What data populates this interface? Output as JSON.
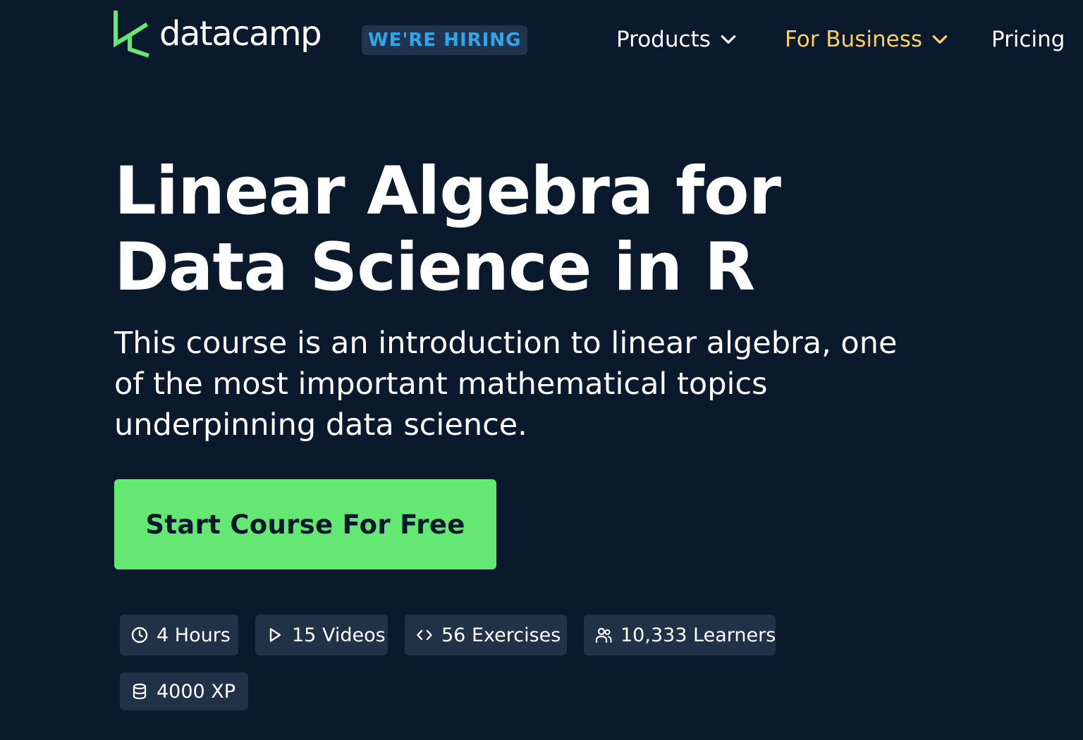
{
  "header": {
    "brand_name": "datacamp",
    "hiring_badge": "WE'RE HIRING",
    "nav": {
      "products": "Products",
      "for_business": "For Business",
      "pricing": "Pricing"
    }
  },
  "hero": {
    "title": "Linear Algebra for Data Science in R",
    "description": "This course is an introduction to linear algebra, one of the most important mathematical topics underpinning data science.",
    "cta_label": "Start Course For Free"
  },
  "stats": {
    "hours": "4 Hours",
    "videos": "15 Videos",
    "exercises": "56 Exercises",
    "learners": "10,333 Learners",
    "xp": "4000 XP"
  },
  "icons": {
    "logo": "datacamp-logo-icon",
    "products_chevron": "chevron-down-icon",
    "business_chevron": "chevron-down-icon",
    "hours": "clock-icon",
    "videos": "play-icon",
    "exercises": "code-icon",
    "learners": "users-icon",
    "xp": "database-icon"
  },
  "colors": {
    "background": "#0b192c",
    "brand_green": "#65e873",
    "hiring_text": "#30a6e8",
    "hiring_bg": "#21344e",
    "business_accent": "#fbd15b",
    "chip_bg": "#213147",
    "cta_text": "#05192d"
  }
}
